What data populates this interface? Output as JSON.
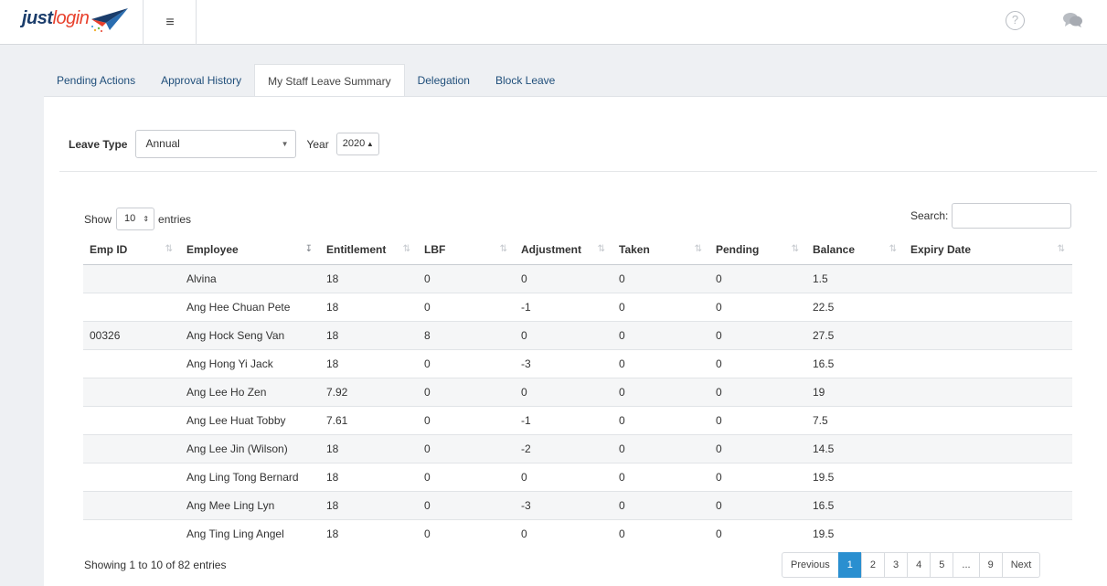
{
  "header": {
    "logo": "justlogin",
    "menu_icon": "hamburger-icon",
    "help_icon": "question-icon",
    "chat_icon": "chat-icon"
  },
  "tabs": [
    {
      "label": "Pending Actions"
    },
    {
      "label": "Approval History"
    },
    {
      "label": "My Staff Leave Summary"
    },
    {
      "label": "Delegation"
    },
    {
      "label": "Block Leave"
    }
  ],
  "filters": {
    "leave_type_label": "Leave Type",
    "leave_type_value": "Annual",
    "year_label": "Year",
    "year_value": "2020"
  },
  "table_controls": {
    "show_label": "Show",
    "entries_value": "10",
    "entries_label": "entries",
    "search_label": "Search:"
  },
  "columns": [
    "Emp ID",
    "Employee",
    "Entitlement",
    "LBF",
    "Adjustment",
    "Taken",
    "Pending",
    "Balance",
    "Expiry Date"
  ],
  "rows": [
    [
      "",
      "Alvina",
      "18",
      "0",
      "0",
      "0",
      "0",
      "1.5",
      ""
    ],
    [
      "",
      "Ang Hee Chuan Pete",
      "18",
      "0",
      "-1",
      "0",
      "0",
      "22.5",
      ""
    ],
    [
      "00326",
      "Ang Hock Seng Van",
      "18",
      "8",
      "0",
      "0",
      "0",
      "27.5",
      ""
    ],
    [
      "",
      "Ang Hong Yi Jack",
      "18",
      "0",
      "-3",
      "0",
      "0",
      "16.5",
      ""
    ],
    [
      "",
      "Ang Lee Ho Zen",
      "7.92",
      "0",
      "0",
      "0",
      "0",
      "19",
      ""
    ],
    [
      "",
      "Ang Lee Huat Tobby",
      "7.61",
      "0",
      "-1",
      "0",
      "0",
      "7.5",
      ""
    ],
    [
      "",
      "Ang Lee Jin (Wilson)",
      "18",
      "0",
      "-2",
      "0",
      "0",
      "14.5",
      ""
    ],
    [
      "",
      "Ang Ling Tong Bernard",
      "18",
      "0",
      "0",
      "0",
      "0",
      "19.5",
      ""
    ],
    [
      "",
      "Ang Mee Ling Lyn",
      "18",
      "0",
      "-3",
      "0",
      "0",
      "16.5",
      ""
    ],
    [
      "",
      "Ang Ting Ling Angel",
      "18",
      "0",
      "0",
      "0",
      "0",
      "19.5",
      ""
    ]
  ],
  "footer": {
    "info": "Showing 1 to 10 of 82 entries",
    "pagination": [
      "Previous",
      "1",
      "2",
      "3",
      "4",
      "5",
      "...",
      "9",
      "Next"
    ]
  },
  "colors": {
    "accent": "#2a8fd0",
    "logo_dark": "#1b3d6b",
    "logo_red": "#e8402c",
    "tab_link": "#1f4e7a"
  }
}
